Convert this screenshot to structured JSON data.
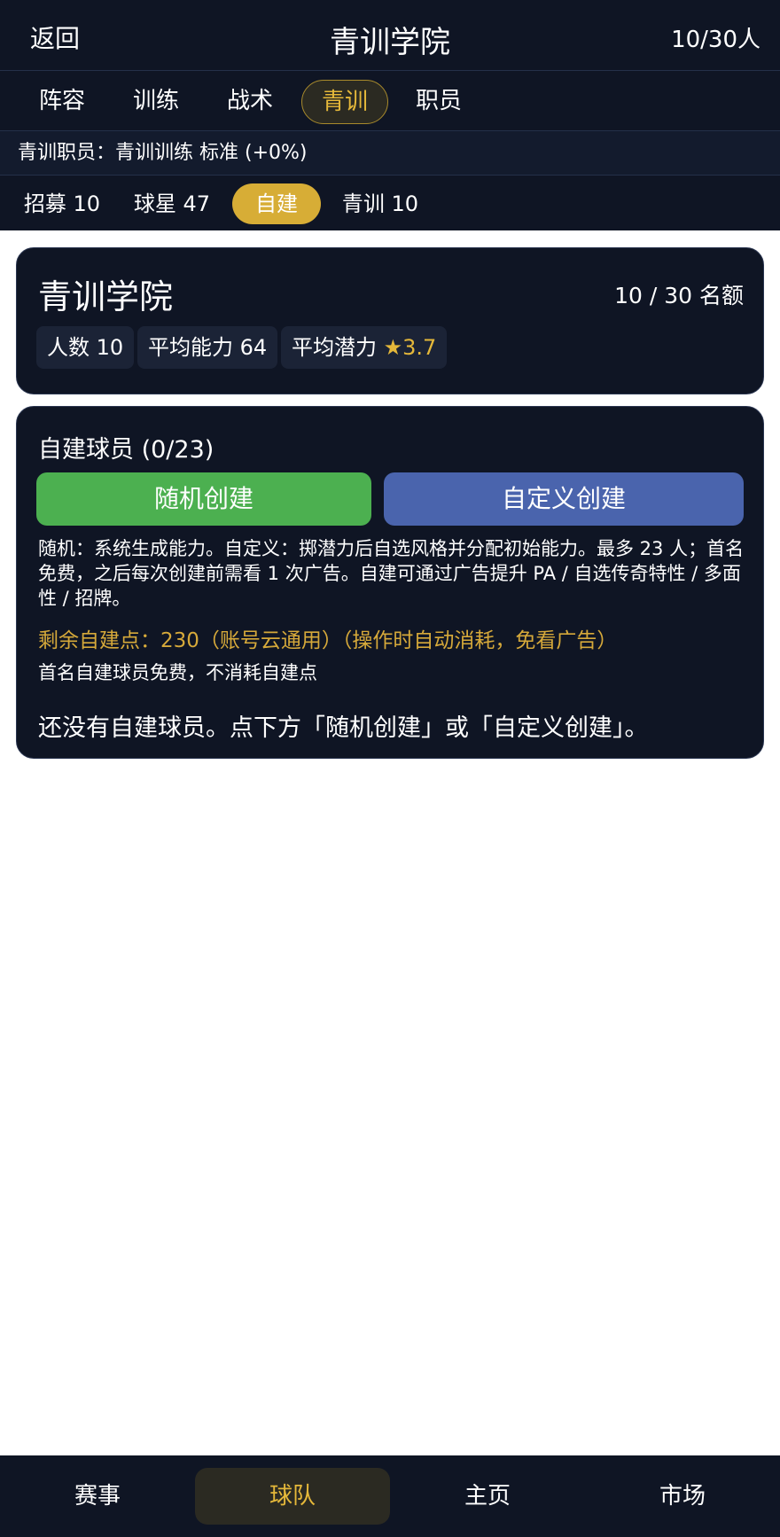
{
  "header": {
    "back_label": "返回",
    "title": "青训学院",
    "count": "10/30人"
  },
  "main_tabs": [
    {
      "label": "阵容",
      "active": false
    },
    {
      "label": "训练",
      "active": false
    },
    {
      "label": "战术",
      "active": false
    },
    {
      "label": "青训",
      "active": true
    },
    {
      "label": "职员",
      "active": false
    }
  ],
  "staff_bar": {
    "text": "青训职员：青训训练 标准 (+0%)"
  },
  "sub_tabs": [
    {
      "label": "招募 10",
      "active": false
    },
    {
      "label": "球星 47",
      "active": false
    },
    {
      "label": "自建",
      "active": true
    },
    {
      "label": "青训 10",
      "active": false
    }
  ],
  "academy_card": {
    "title": "青训学院",
    "quota": "10 / 30 名额",
    "stats": {
      "headcount": "人数 10",
      "avg_ability": "平均能力 64",
      "avg_potential_label": "平均潜力",
      "avg_potential_star": "★",
      "avg_potential_value": "3.7"
    }
  },
  "custom_card": {
    "heading": "自建球员 (0/23)",
    "random_button": "随机创建",
    "custom_button": "自定义创建",
    "description": "随机：系统生成能力。自定义：掷潜力后自选风格并分配初始能力。最多 23 人；首名免费，之后每次创建前需看 1 次广告。自建可通过广告提升 PA / 自选传奇特性 / 多面性 / 招牌。",
    "points_text": "剩余自建点：230（账号云通用）（操作时自动消耗，免看广告）",
    "free_note": "首名自建球员免费，不消耗自建点",
    "empty_message": "还没有自建球员。点下方「随机创建」或「自定义创建」。"
  },
  "bottom_nav": [
    {
      "label": "赛事",
      "active": false
    },
    {
      "label": "球队",
      "active": true
    },
    {
      "label": "主页",
      "active": false
    },
    {
      "label": "市场",
      "active": false
    }
  ],
  "colors": {
    "dark_bg": "#0f1524",
    "accent_gold": "#e5b83a",
    "random_green": "#4cb050",
    "custom_blue": "#4a64ad"
  }
}
